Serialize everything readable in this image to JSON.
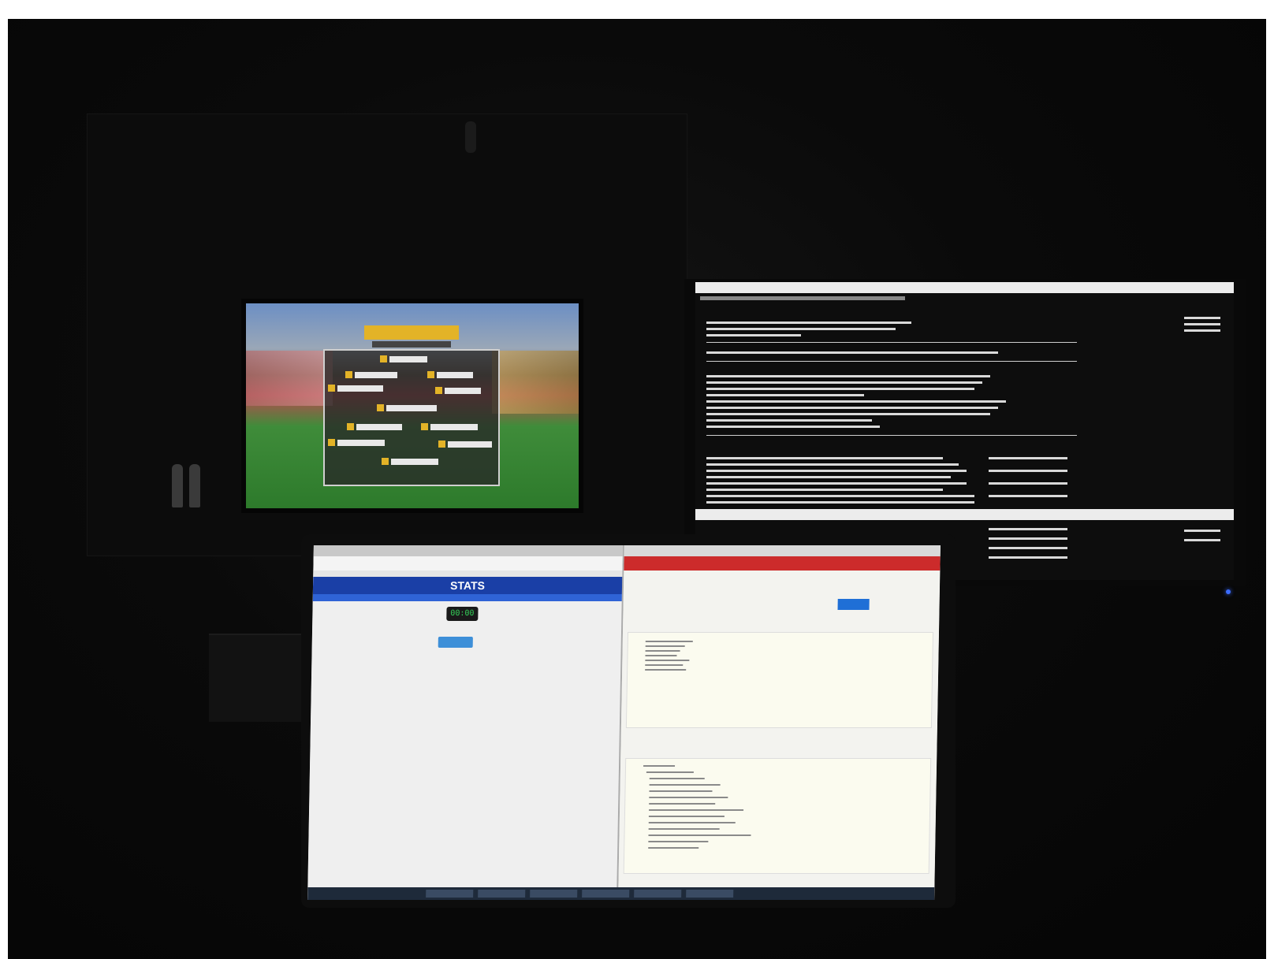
{
  "photo": {
    "description_free": true
  },
  "laptop_browser": {
    "header_title": "STATS",
    "timer": "00:00"
  },
  "colors": {
    "stats_header": "#1a3fa6",
    "timer_text": "#34d058",
    "ide_toolbar": "#cc2b2b",
    "led": "#3b6cff"
  }
}
